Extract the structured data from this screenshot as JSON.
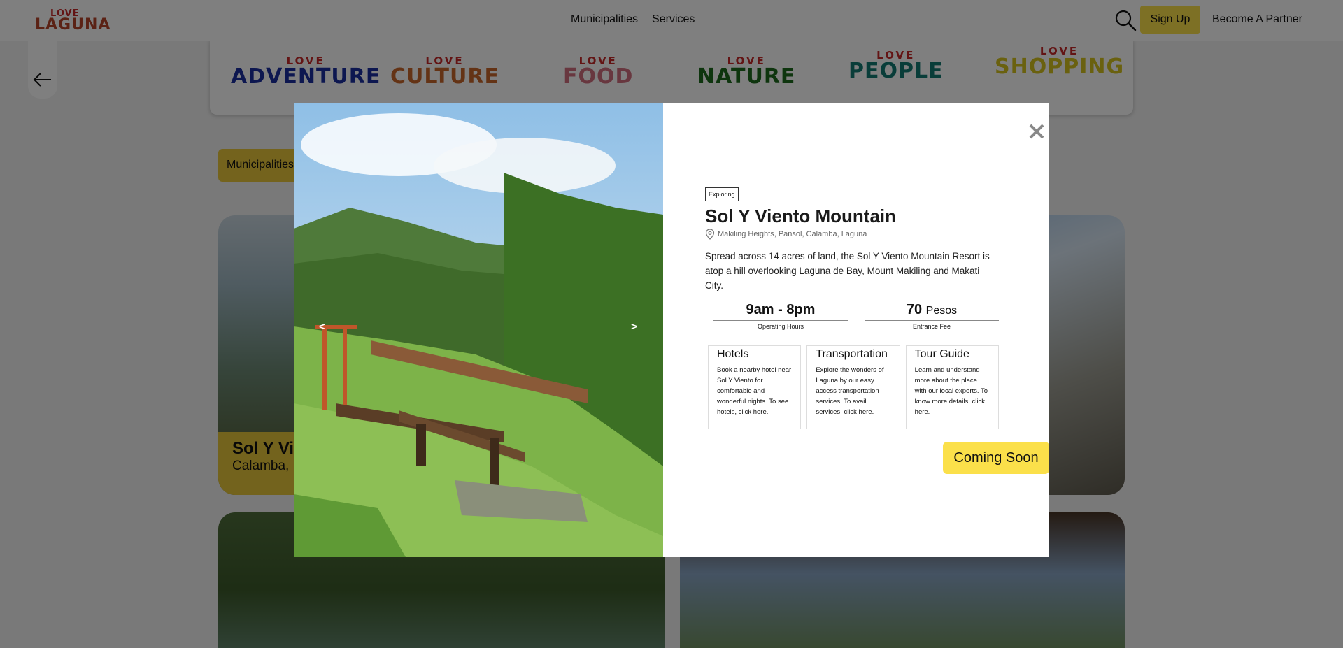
{
  "nav": {
    "logo_top": "LOVE",
    "logo_bottom": "LAGUNA",
    "links": [
      "Municipalities",
      "Services"
    ],
    "signup": "Sign Up",
    "partner": "Become A Partner"
  },
  "categories": [
    {
      "love": "LOVE",
      "word": "ADVENTURE",
      "color": "#1a2fa0"
    },
    {
      "love": "LOVE",
      "word": "CULTURE",
      "color": "#c8672a"
    },
    {
      "love": "LOVE",
      "word": "FOOD",
      "color": "#d16f7e"
    },
    {
      "love": "LOVE",
      "word": "NATURE",
      "color": "#1c6b1c"
    },
    {
      "love": "LOVE",
      "word": "PEOPLE",
      "color": "#127a72"
    },
    {
      "love": "LOVE",
      "word": "SHOPPING",
      "color": "#d4c21e"
    }
  ],
  "filter": {
    "label": "Municipalities"
  },
  "bg_card": {
    "title": "Sol Y Vi",
    "subtitle": "Calamba,"
  },
  "modal": {
    "photo_prev": "<",
    "photo_next": ">",
    "tag": "Exploring",
    "title": "Sol Y Viento Mountain",
    "location": "Makiling Heights, Pansol, Calamba, Laguna",
    "description": "Spread across 14 acres of land, the Sol Y Viento Mountain Resort is atop a hill overlooking Laguna de Bay, Mount Makiling and Makati City.",
    "hours_value": "9am - 8pm",
    "hours_label": "Operating Hours",
    "fee_value": "70",
    "fee_unit": "Pesos",
    "fee_label": "Entrance Fee",
    "services": [
      {
        "title": "Hotels",
        "text": "Book a nearby hotel near Sol Y Viento for comfortable and wonderful nights. To see hotels, click here."
      },
      {
        "title": "Transportation",
        "text": "Explore the wonders of Laguna by our easy access transportation services. To avail services, click here."
      },
      {
        "title": "Tour Guide",
        "text": "Learn and understand more about the place with our local experts. To know more details, click here."
      }
    ],
    "cta": "Coming Soon"
  }
}
